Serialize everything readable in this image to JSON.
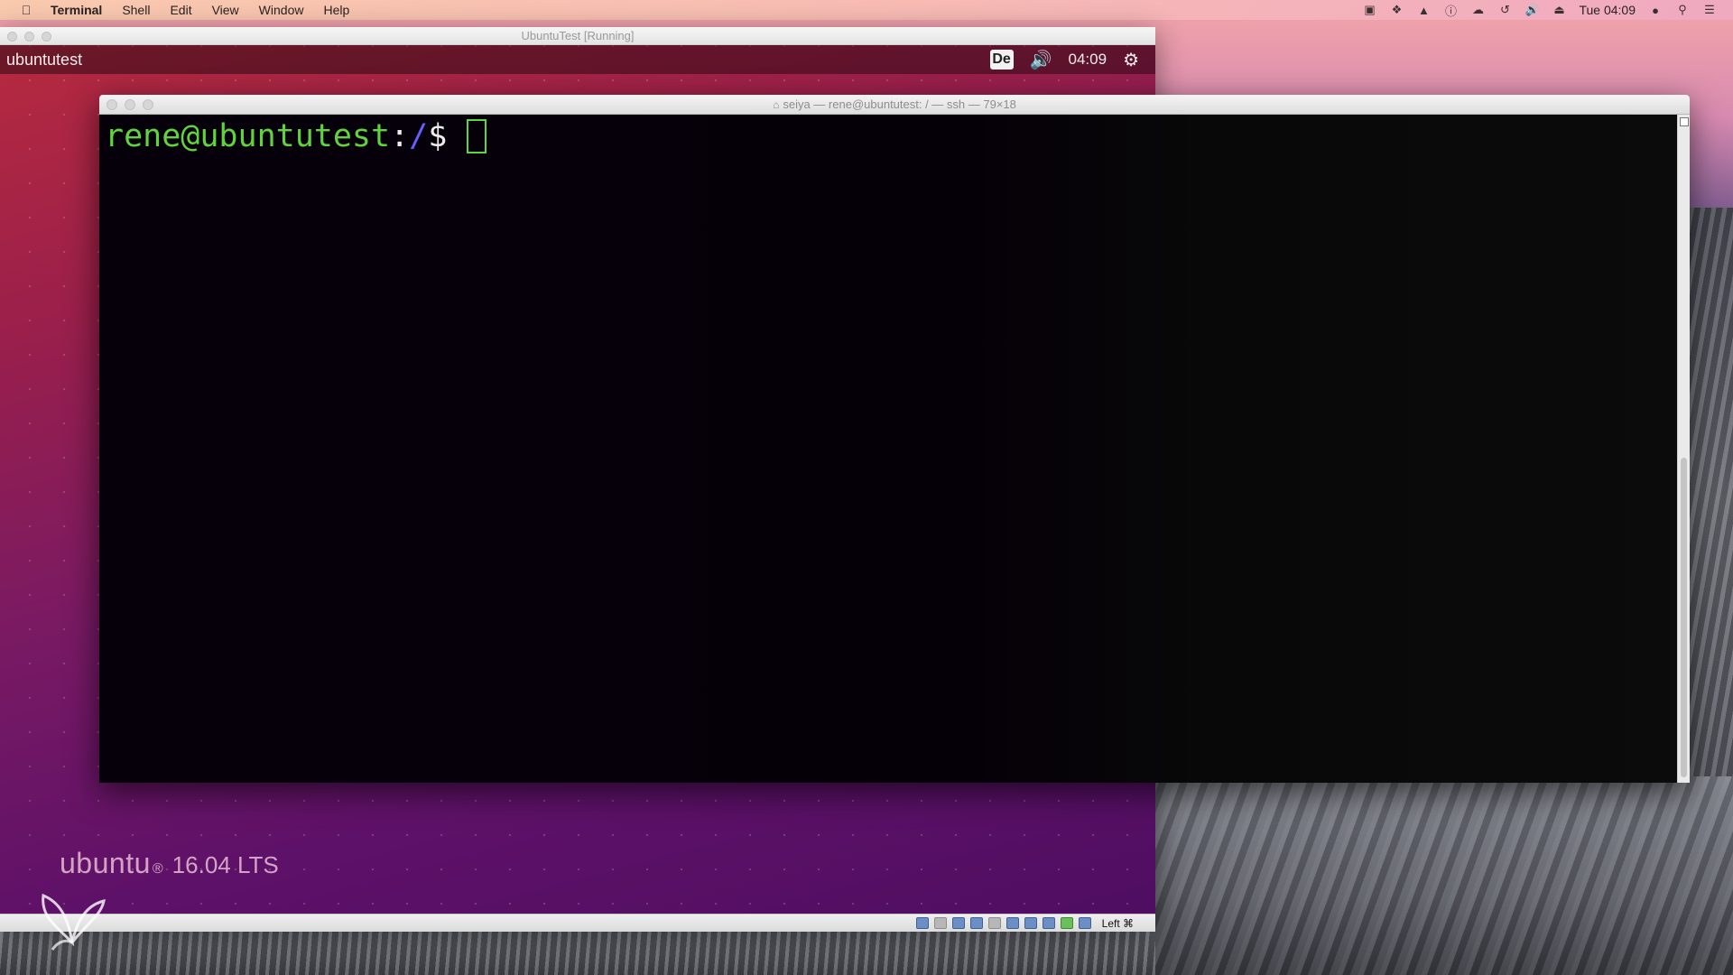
{
  "mac_menubar": {
    "app_name": "Terminal",
    "menus": [
      "Shell",
      "Edit",
      "View",
      "Window",
      "Help"
    ],
    "clock": "Tue 04:09",
    "status_icons": [
      "screen-record-icon",
      "dropbox-icon",
      "drive-icon",
      "info-icon",
      "cloud-icon",
      "time-machine-icon",
      "volume-icon",
      "eject-icon",
      "user-icon",
      "spotlight-icon",
      "notification-center-icon"
    ]
  },
  "vbox": {
    "title": "UbuntuTest [Running]",
    "host_key": "Left ⌘",
    "status_icons": [
      "hdd-icon",
      "optical-icon",
      "audio-icon",
      "network-icon",
      "usb-icon",
      "shared-folders-icon",
      "display-icon",
      "video-capture-icon",
      "mouse-integration-icon",
      "host-key-icon"
    ]
  },
  "ubuntu": {
    "host_name": "ubuntutest",
    "keyboard_layout": "De",
    "time": "04:09",
    "brand_word": "ubuntu",
    "brand_reg": "®",
    "brand_version": "16.04 LTS"
  },
  "terminal": {
    "title": "seiya — rene@ubuntutest: / — ssh — 79×18",
    "prompt_user_host": "rene@ubuntutest",
    "prompt_colon": ":",
    "prompt_path": "/",
    "prompt_symbol": "$"
  }
}
